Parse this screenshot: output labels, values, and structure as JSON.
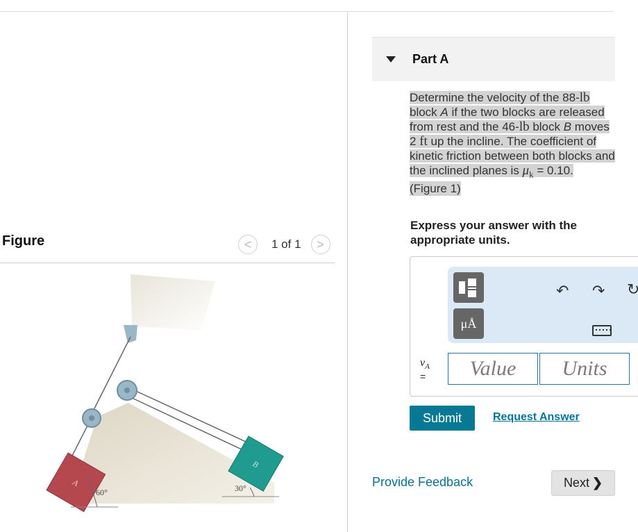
{
  "figure_panel": {
    "title": "Figure",
    "pager_text": "1 of 1",
    "prev_glyph": "<",
    "next_glyph": ">",
    "labels": {
      "block_a": "A",
      "block_b": "B",
      "angle_a": "60°",
      "angle_b": "30°"
    }
  },
  "part": {
    "title": "Part A",
    "problem": {
      "t1": "Determine the velocity of the 88-",
      "unit_lb": "lb",
      "t2": " block ",
      "a": "A",
      "t3": " if the two blocks are released from rest and the 46-",
      "t4": " block ",
      "b": "B",
      "t5": " moves 2 ",
      "unit_ft": "ft",
      "t6": " up the incline. The coefficient of kinetic friction between both blocks and the inclined planes is ",
      "mu": "μ",
      "mu_sub": "k",
      "t7": " = 0.10.",
      "figure_ref": "(Figure 1)"
    },
    "express": "Express your answer with the appropriate units."
  },
  "answer": {
    "var": "v",
    "var_sub": "A",
    "eq": "=",
    "value_placeholder": "Value",
    "units_placeholder": "Units",
    "toolbar": {
      "units_button": "μÅ",
      "undo_icon": "undo-icon",
      "redo_icon": "redo-icon",
      "reset_icon": "reset-icon",
      "keyboard_icon": "keyboard-icon"
    }
  },
  "actions": {
    "submit": "Submit",
    "request_answer": "Request Answer",
    "feedback": "Provide Feedback",
    "next": "Next",
    "next_chevron": "❯"
  },
  "colors": {
    "submit_bg": "#087994",
    "link": "#06749a",
    "toolbar_bg": "#dbe9f7",
    "block_a": "#b5474f",
    "block_b": "#1f9b8f",
    "highlight": "#d3d3d3"
  }
}
